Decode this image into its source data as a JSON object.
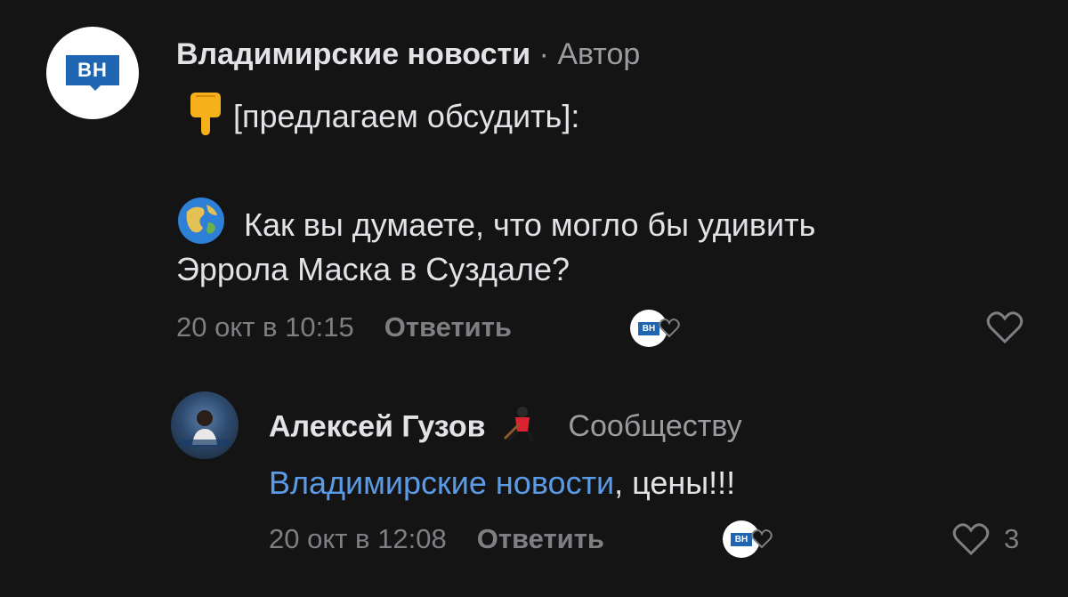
{
  "comment1": {
    "author_name": "Владимирские новости",
    "separator": " · ",
    "author_role": "Автор",
    "avatar_text": "ВН",
    "line1": "[предлагаем обсудить]:",
    "line2": "Как вы думаете, что могло бы удивить",
    "line3": "Эррола Маска в Суздале?",
    "time": "20 окт в 10:15",
    "reply_label": "Ответить",
    "mini_avatar_text": "ВН"
  },
  "comment2": {
    "author_name": "Алексей Гузов",
    "author_role": "Сообществу",
    "mention": "Владимирские новости",
    "text_rest": ", цены!!!",
    "time": "20 окт в 12:08",
    "reply_label": "Ответить",
    "mini_avatar_text": "ВН",
    "likes": "3"
  },
  "colors": {
    "background": "#141414",
    "brand_blue": "#1f66b2",
    "mention": "#5b9ae6",
    "muted": "#7d7f83"
  },
  "icons": [
    "pointing-down-emoji",
    "globe-emoji",
    "heart-icon",
    "hockey-player-emoji"
  ]
}
